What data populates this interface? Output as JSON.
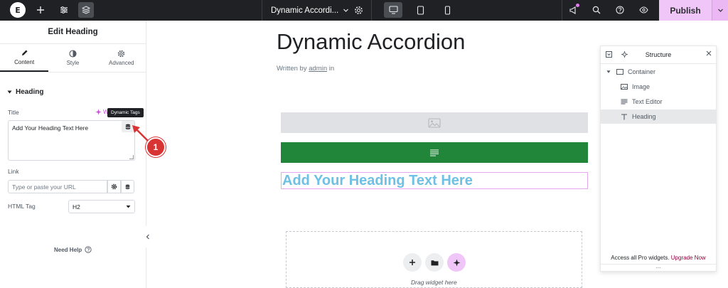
{
  "topbar": {
    "logo_letter": "E",
    "page_name": "Dynamic Accordi...",
    "publish_label": "Publish"
  },
  "panel": {
    "title": "Edit Heading",
    "tabs": [
      {
        "label": "Content",
        "icon": "pencil-icon"
      },
      {
        "label": "Style",
        "icon": "half-circle-icon"
      },
      {
        "label": "Advanced",
        "icon": "gear-icon"
      }
    ],
    "section_title": "Heading",
    "title_label": "Title",
    "ai_link_label": "W",
    "tooltip": "Dynamic Tags",
    "title_value": "Add Your Heading Text Here",
    "link_label": "Link",
    "link_placeholder": "Type or paste your URL",
    "html_tag_label": "HTML Tag",
    "html_tag_value": "H2",
    "need_help": "Need Help"
  },
  "annotation": {
    "step": "1"
  },
  "canvas": {
    "page_title": "Dynamic Accordion",
    "byline_prefix": "Written by",
    "byline_author": "admin",
    "byline_suffix": "in",
    "heading_text": "Add Your Heading Text Here",
    "drop_text": "Drag widget here"
  },
  "structure": {
    "title": "Structure",
    "items": [
      {
        "label": "Container",
        "icon": "container-icon"
      },
      {
        "label": "Image",
        "icon": "image-icon"
      },
      {
        "label": "Text Editor",
        "icon": "text-editor-icon"
      },
      {
        "label": "Heading",
        "icon": "heading-icon"
      }
    ],
    "footer_prefix": "Access all Pro widgets.",
    "footer_link": "Upgrade Now",
    "grip": "..."
  },
  "colors": {
    "topbar": "#1f2124",
    "publish": "#f0c5f7",
    "accent_pink": "#c94dd8",
    "text_widget_green": "#22863a",
    "heading_blue": "#6ec1e4",
    "marker_red": "#d93434",
    "upgrade_link": "#93003c"
  }
}
